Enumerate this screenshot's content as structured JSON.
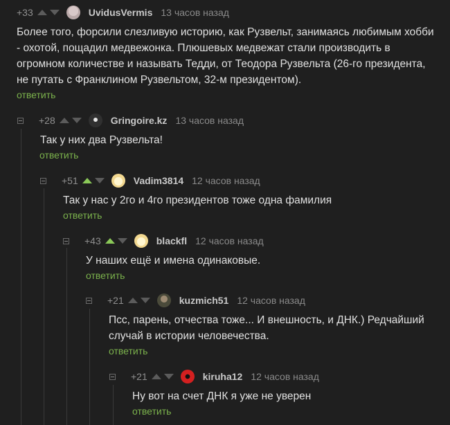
{
  "comments": [
    {
      "rating": "+33",
      "username": "UvidusVermis",
      "time": "13 часов назад",
      "text": "Более того, форсили слезливую историю, как Рузвельт, занимаясь любимым хобби\n- охотой, пощадил медвежонка. Плюшевых медвежат стали производить в\nогромном количестве и называть Тедди, от Теодора Рузвельта (26-го президента,\nне путать с Франклином Рузвельтом, 32-м президентом).",
      "reply": "ответить",
      "upvoted": false
    },
    {
      "rating": "+28",
      "username": "Gringoire.kz",
      "time": "13 часов назад",
      "text": "Так у них два Рузвельта!",
      "reply": "ответить",
      "upvoted": false
    },
    {
      "rating": "+51",
      "username": "Vadim3814",
      "time": "12 часов назад",
      "text": "Так у нас у 2го и 4го президентов тоже одна фамилия",
      "reply": "ответить",
      "upvoted": true
    },
    {
      "rating": "+43",
      "username": "blackfl",
      "time": "12 часов назад",
      "text": "У наших ещё и имена одинаковые.",
      "reply": "ответить",
      "upvoted": true
    },
    {
      "rating": "+21",
      "username": "kuzmich51",
      "time": "12 часов назад",
      "text": "Псс, парень, отчества тоже... И внешность, и ДНК.) Редчайший\nслучай в истории человечества.",
      "reply": "ответить",
      "upvoted": false
    },
    {
      "rating": "+21",
      "username": "kiruha12",
      "time": "12 часов назад",
      "text": "Ну вот на счет ДНК я уже не уверен",
      "reply": "ответить",
      "upvoted": false
    }
  ],
  "colors": {
    "background": "#1f1f1f",
    "reply_link": "#7bb24c",
    "upvote_active": "#8ac858"
  }
}
